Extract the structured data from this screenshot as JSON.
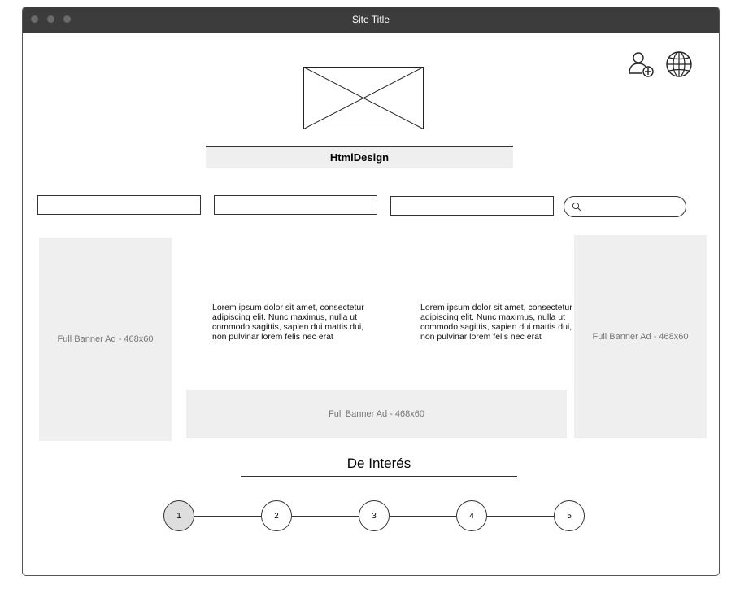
{
  "window": {
    "title": "Site Title"
  },
  "header": {
    "brand": "HtmlDesign",
    "logo_icon": "image-placeholder-icon",
    "icons": [
      "add-user-icon",
      "globe-icon"
    ]
  },
  "nav": {
    "fields": [
      "",
      "",
      ""
    ],
    "search": {
      "placeholder": "",
      "icon": "search-icon"
    }
  },
  "ads": {
    "left": "Full Banner Ad - 468x60",
    "right": "Full Banner Ad - 468x60",
    "center": "Full Banner Ad - 468x60"
  },
  "content": {
    "col1": "Lorem ipsum dolor sit amet, consectetur adipiscing elit. Nunc maximus, nulla ut commodo sagittis, sapien dui mattis dui, non pulvinar lorem felis nec erat",
    "col2": "Lorem ipsum dolor sit amet, consectetur adipiscing elit. Nunc maximus, nulla ut commodo sagittis, sapien dui mattis dui, non pulvinar lorem felis nec erat"
  },
  "interes": {
    "title": "De Interés"
  },
  "pagination": {
    "pages": [
      "1",
      "2",
      "3",
      "4",
      "5"
    ],
    "active": "1"
  },
  "colors": {
    "titlebar": "#3c3c3c",
    "placeholder": "#efefef",
    "active_page": "#dedede"
  }
}
